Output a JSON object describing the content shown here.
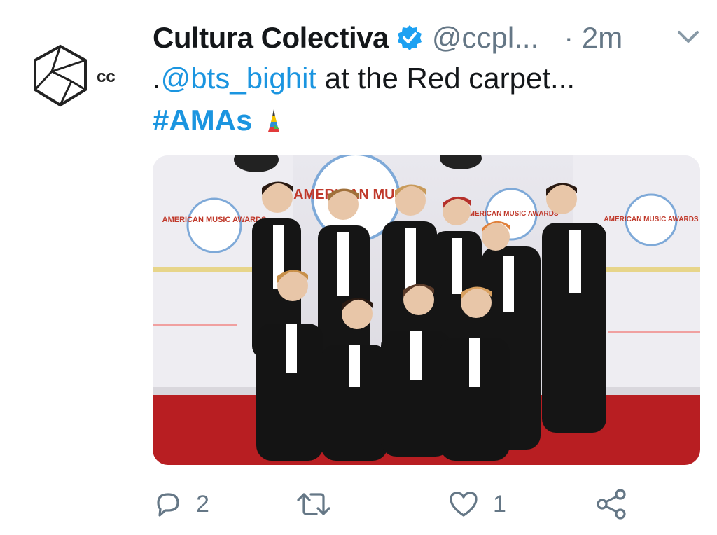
{
  "tweet": {
    "avatar_label": "cc",
    "display_name": "Cultura Colectiva",
    "handle": "@ccpl...",
    "time": "· 2m",
    "text_prefix": ".",
    "mention": "@bts_bighit",
    "text_rest": " at the Red carpet...",
    "hashtag": "#AMAs",
    "emoji": "rocket-flag-icon"
  },
  "media": {
    "backdrop_labels": [
      "AMERICAN MUSIC",
      "AMERICAN MUSIC AWARDS",
      "AMERICAN MUSIC AWARDS",
      "AMERICAN MUSIC AWARDS"
    ]
  },
  "actions": {
    "reply_count": "2",
    "retweet_count": "",
    "like_count": "1"
  },
  "colors": {
    "link": "#1b95e0",
    "muted": "#657786",
    "carpet": "#b81e22"
  }
}
